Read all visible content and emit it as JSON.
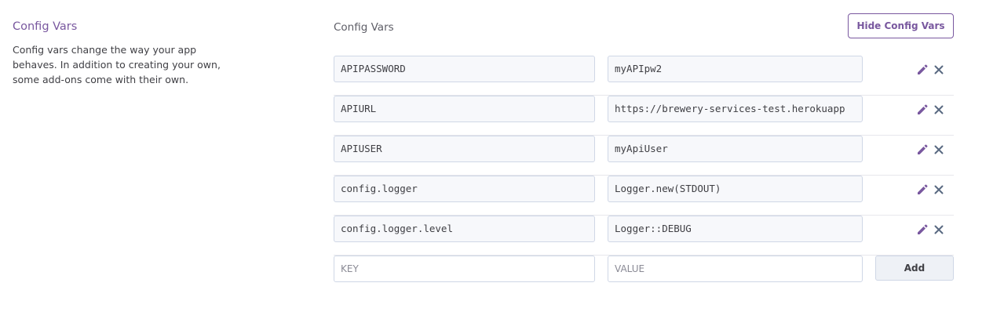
{
  "sidebar": {
    "title": "Config Vars",
    "description": "Config vars change the way your app behaves. In addition to creating your own, some add-ons come with their own."
  },
  "section": {
    "title": "Config Vars",
    "hide_button_label": "Hide Config Vars"
  },
  "config_vars": [
    {
      "key": "APIPASSWORD",
      "value": "myAPIpw2"
    },
    {
      "key": "APIURL",
      "value": "https://brewery-services-test.herokuapp"
    },
    {
      "key": "APIUSER",
      "value": "myApiUser"
    },
    {
      "key": "config.logger",
      "value": "Logger.new(STDOUT)"
    },
    {
      "key": "config.logger.level",
      "value": "Logger::DEBUG"
    }
  ],
  "new_var": {
    "key_placeholder": "KEY",
    "value_placeholder": "VALUE",
    "add_label": "Add"
  },
  "icons": {
    "edit": "pencil-icon",
    "delete": "close-icon"
  },
  "colors": {
    "accent": "#79589f",
    "icon": "#596981",
    "border": "#cfd7e6",
    "field_bg": "#f7f8fb"
  }
}
